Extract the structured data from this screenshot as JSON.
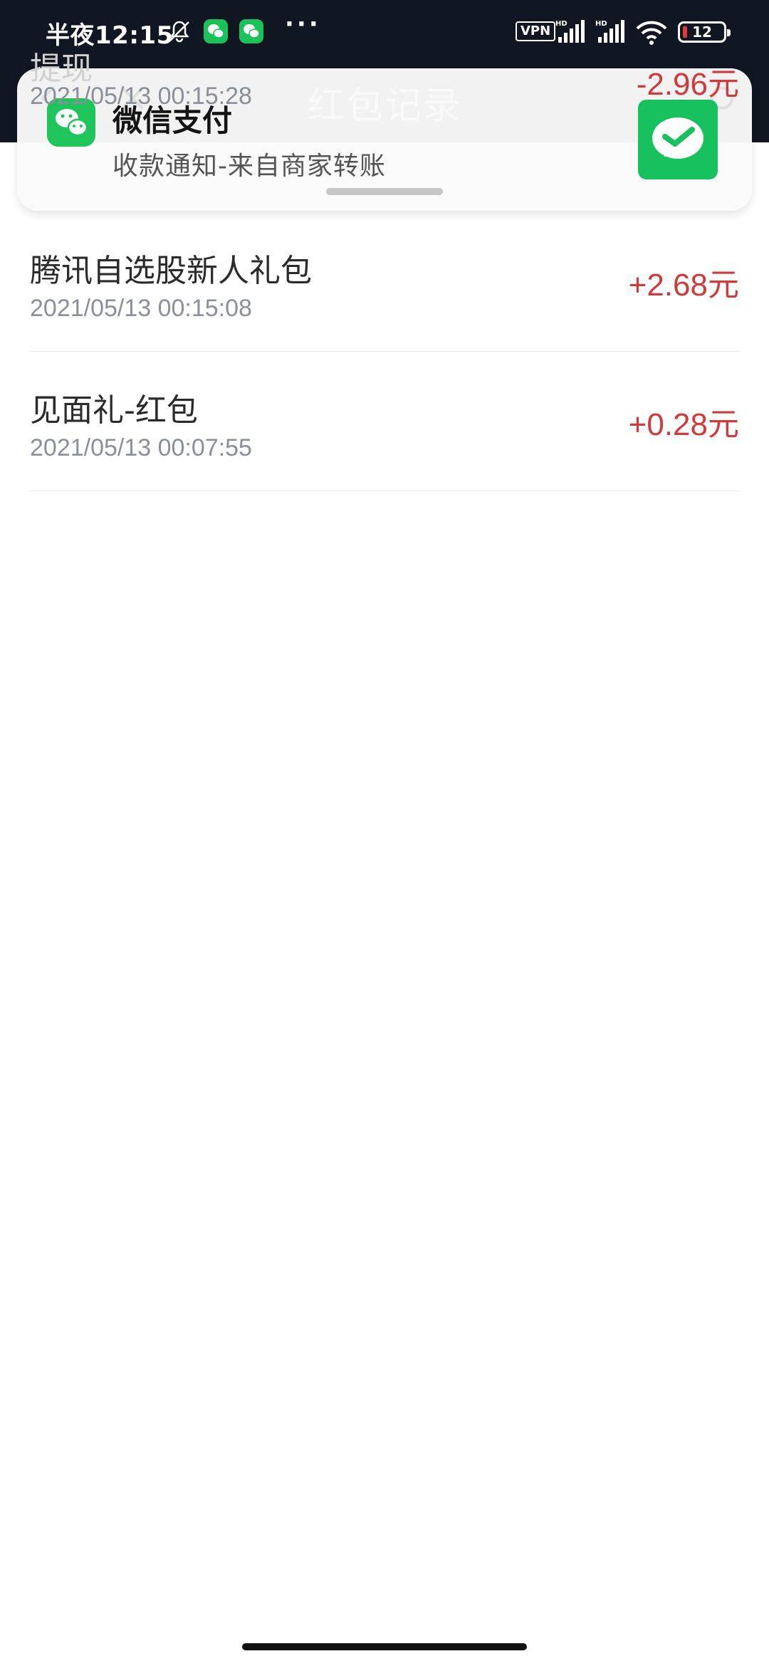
{
  "status_bar": {
    "time": "半夜12:15",
    "more": "···",
    "vpn": "VPN",
    "battery": "12",
    "icons": [
      "notifications-off-icon",
      "wechat-icon",
      "wechat-icon",
      "signal-icon",
      "signal-icon",
      "wifi-icon",
      "battery-icon"
    ]
  },
  "page_header": {
    "title": "红包记录",
    "icons": [
      "back-icon",
      "close-icon",
      "refresh-icon"
    ]
  },
  "notification": {
    "app_name": "微信支付",
    "body": "收款通知-来自商家转账",
    "icons": [
      "wechat-icon",
      "wechat-pay-icon"
    ]
  },
  "records": [
    {
      "title": "提现",
      "time": "2021/05/13 00:15:28",
      "amount": "-2.96元"
    },
    {
      "title": "腾讯自选股新人礼包",
      "time": "2021/05/13 00:15:08",
      "amount": "+2.68元"
    },
    {
      "title": "见面礼-红包",
      "time": "2021/05/13 00:07:55",
      "amount": "+0.28元"
    }
  ],
  "colors": {
    "status_bar_bg": "#111722",
    "amount": "#cf3b3b",
    "wechat_green": "#1fc45b"
  }
}
